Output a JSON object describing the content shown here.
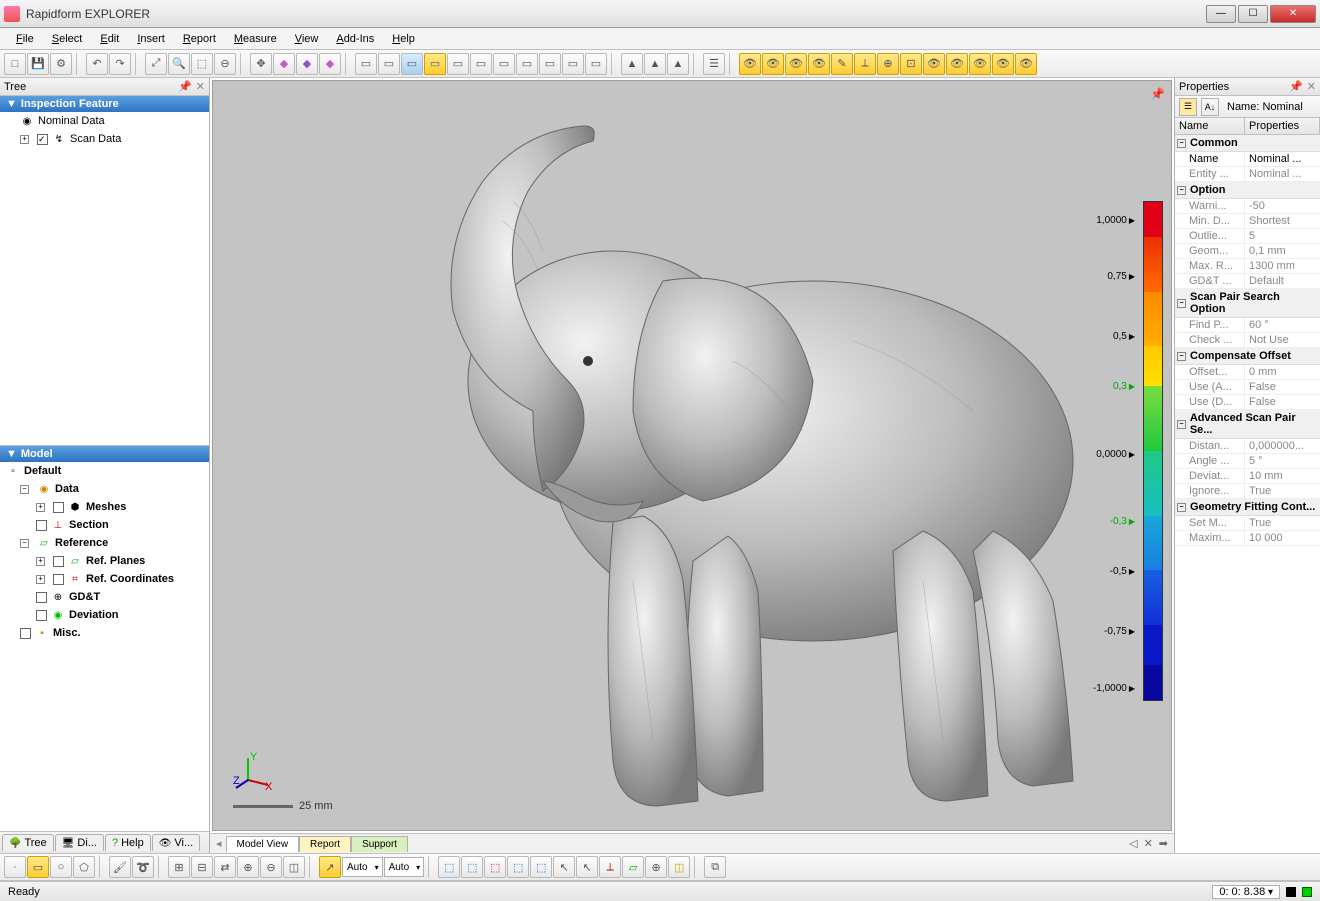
{
  "app": {
    "title": "Rapidform EXPLORER"
  },
  "menu": [
    "File",
    "Select",
    "Edit",
    "Insert",
    "Report",
    "Measure",
    "View",
    "Add-Ins",
    "Help"
  ],
  "tree_panel": {
    "title": "Tree",
    "inspection_header": "Inspection Feature",
    "items": [
      {
        "label": "Nominal Data"
      },
      {
        "label": "Scan Data"
      }
    ],
    "model_header": "Model",
    "model_tree": [
      {
        "label": "Default",
        "level": 0
      },
      {
        "label": "Data",
        "level": 1
      },
      {
        "label": "Meshes",
        "level": 2
      },
      {
        "label": "Section",
        "level": 2
      },
      {
        "label": "Reference",
        "level": 1
      },
      {
        "label": "Ref. Planes",
        "level": 2
      },
      {
        "label": "Ref. Coordinates",
        "level": 2
      },
      {
        "label": "GD&T",
        "level": 2
      },
      {
        "label": "Deviation",
        "level": 2
      },
      {
        "label": "Misc.",
        "level": 1
      }
    ],
    "bottom_tabs": [
      "Tree",
      "Di...",
      "Help",
      "Vi..."
    ]
  },
  "viewport": {
    "tabs": [
      "Model View",
      "Report",
      "Support"
    ],
    "scale_label": "25 mm",
    "colorbar": {
      "labels": [
        "1,0000",
        "0,75",
        "0,5",
        "0,3",
        "0,0000",
        "-0,3",
        "-0,5",
        "-0,75",
        "-1,0000"
      ]
    }
  },
  "properties": {
    "title": "Properties",
    "name_label": "Name: Nominal",
    "columns": [
      "Name",
      "Properties"
    ],
    "groups": [
      {
        "name": "Common",
        "rows": [
          {
            "n": "Name",
            "v": "Nominal ..."
          },
          {
            "n": "Entity ...",
            "v": "Nominal ..."
          }
        ]
      },
      {
        "name": "Option",
        "rows": [
          {
            "n": "Warni...",
            "v": "-50"
          },
          {
            "n": "Min. D...",
            "v": "Shortest"
          },
          {
            "n": "Outlie...",
            "v": "5"
          },
          {
            "n": "Geom...",
            "v": "0,1 mm"
          },
          {
            "n": "Max. R...",
            "v": "1300 mm"
          },
          {
            "n": "GD&T ...",
            "v": "Default"
          }
        ]
      },
      {
        "name": "Scan Pair Search Option",
        "rows": [
          {
            "n": "Find P...",
            "v": "60 °"
          },
          {
            "n": "Check ...",
            "v": "Not Use"
          }
        ]
      },
      {
        "name": "Compensate Offset",
        "rows": [
          {
            "n": "Offset...",
            "v": "0 mm"
          },
          {
            "n": "Use (A...",
            "v": "False"
          },
          {
            "n": "Use (D...",
            "v": "False"
          }
        ]
      },
      {
        "name": "Advanced Scan Pair Se...",
        "rows": [
          {
            "n": "Distan...",
            "v": "0,000000..."
          },
          {
            "n": "Angle ...",
            "v": "5 °"
          },
          {
            "n": "Deviat...",
            "v": "10 mm"
          },
          {
            "n": "Ignore...",
            "v": "True"
          }
        ]
      },
      {
        "name": "Geometry Fitting Cont...",
        "rows": [
          {
            "n": "Set M...",
            "v": "True"
          },
          {
            "n": "Maxim...",
            "v": "10 000"
          }
        ]
      }
    ]
  },
  "toolbar2": {
    "auto1": "Auto",
    "auto2": "Auto"
  },
  "status": {
    "left": "Ready",
    "time": "0: 0: 8.38"
  }
}
